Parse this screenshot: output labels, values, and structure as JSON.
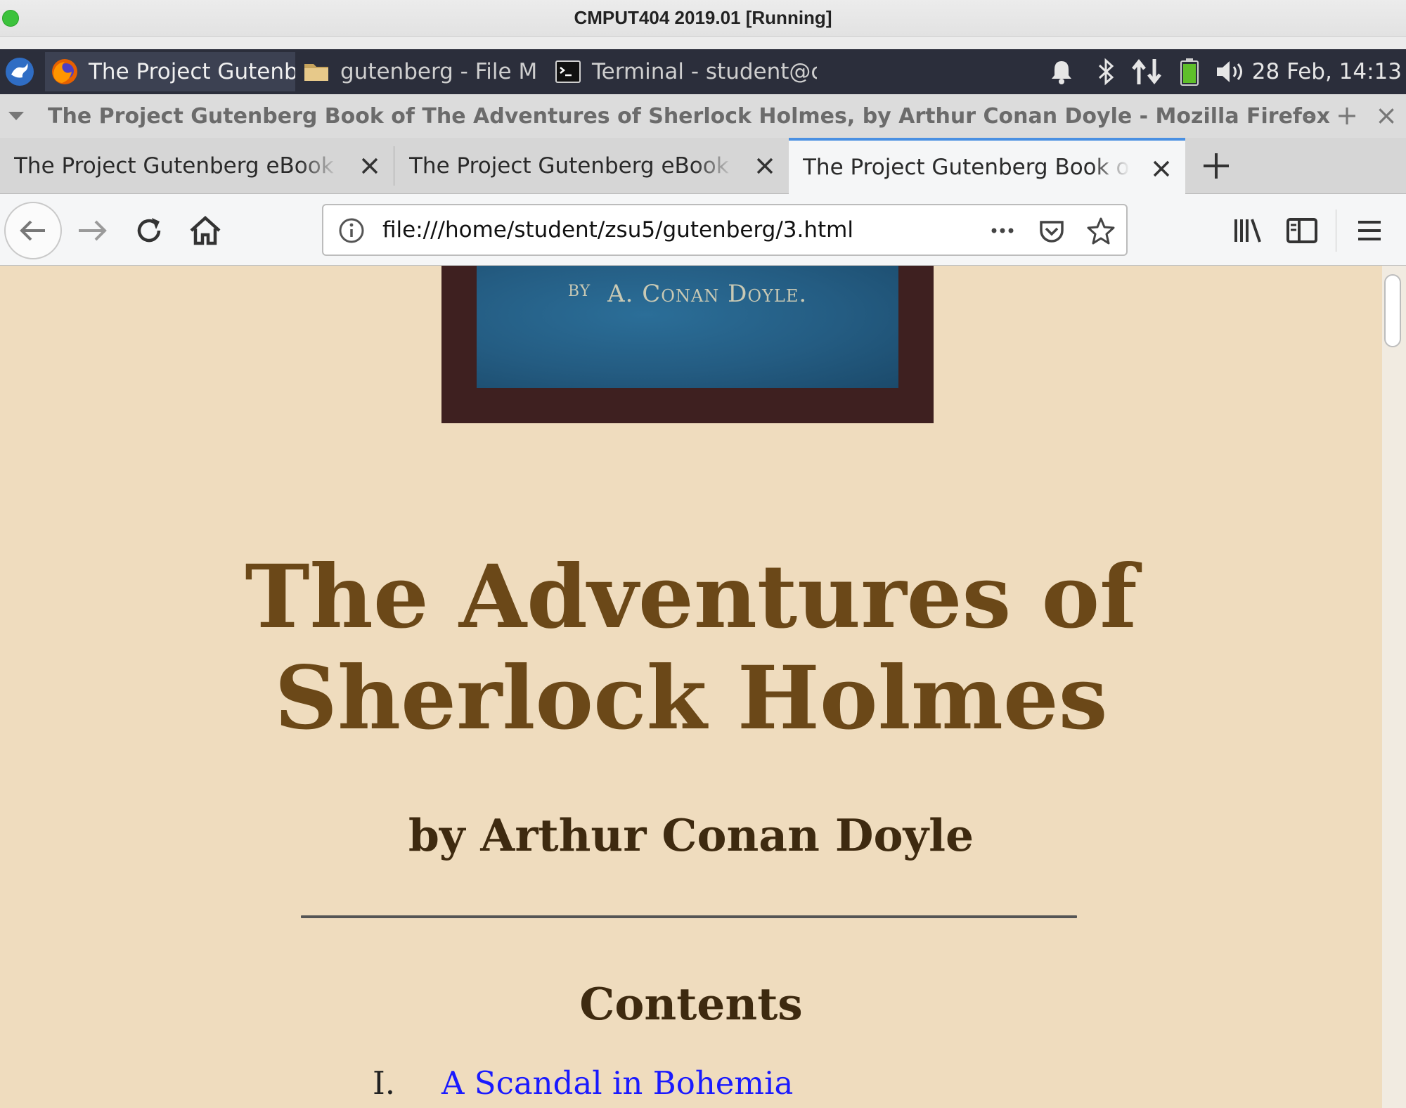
{
  "vm": {
    "title": "CMPUT404 2019.01 [Running]"
  },
  "panel": {
    "tasks": [
      {
        "label": "The Project Gutenberg Bo...",
        "icon": "firefox-icon"
      },
      {
        "label": "gutenberg - File Manager",
        "icon": "folder-icon"
      },
      {
        "label": "Terminal - student@cmpu...",
        "icon": "terminal-icon"
      }
    ],
    "clock": "28 Feb, 14:13"
  },
  "firefox": {
    "window_title": "The Project Gutenberg Book of The Adventures of Sherlock Holmes, by Arthur Conan Doyle - Mozilla Firefox",
    "tabs": [
      {
        "label": "The Project Gutenberg eBook of Pride"
      },
      {
        "label": "The Project Gutenberg eBook of The"
      },
      {
        "label": "The Project Gutenberg Book of The"
      }
    ],
    "url": "file:///home/student/zsu5/gutenberg/3.html"
  },
  "page": {
    "cover_by": "BY",
    "cover_author": "A. Conan Doyle.",
    "title_line1": "The Adventures of",
    "title_line2": "Sherlock Holmes",
    "author": "by Arthur Conan Doyle",
    "contents_heading": "Contents",
    "toc": [
      {
        "num": "I.",
        "title": "A Scandal in Bohemia"
      }
    ]
  },
  "colors": {
    "page_bg": "#efdcbe",
    "title": "#6b4818",
    "link": "#1a1aff",
    "panel_bg": "#2b2e3b"
  }
}
